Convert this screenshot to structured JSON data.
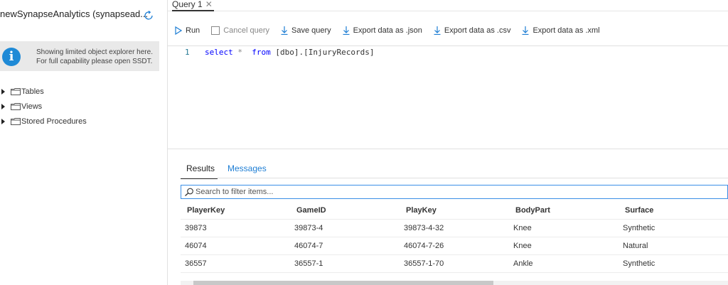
{
  "explorer": {
    "title": "newSynapseAnalytics (synapsead...",
    "info_line1": "Showing limited object explorer here.",
    "info_line2": "For full capability please open SSDT.",
    "tree": [
      {
        "label": "Tables"
      },
      {
        "label": "Views"
      },
      {
        "label": "Stored Procedures"
      }
    ]
  },
  "tabs": [
    {
      "label": "Query 1"
    }
  ],
  "toolbar": {
    "run": "Run",
    "cancel": "Cancel query",
    "save": "Save query",
    "export_json": "Export data as .json",
    "export_csv": "Export data as .csv",
    "export_xml": "Export data as .xml"
  },
  "editor": {
    "line_number": "1",
    "kw_select": "select",
    "star": "*",
    "kw_from": "from",
    "table": "[dbo].[InjuryRecords]"
  },
  "results": {
    "tab_results": "Results",
    "tab_messages": "Messages",
    "filter_placeholder": "Search to filter items...",
    "columns": [
      "PlayerKey",
      "GameID",
      "PlayKey",
      "BodyPart",
      "Surface"
    ],
    "rows": [
      [
        "39873",
        "39873-4",
        "39873-4-32",
        "Knee",
        "Synthetic"
      ],
      [
        "46074",
        "46074-7",
        "46074-7-26",
        "Knee",
        "Natural"
      ],
      [
        "36557",
        "36557-1",
        "36557-1-70",
        "Ankle",
        "Synthetic"
      ]
    ]
  },
  "colors": {
    "accent": "#1e7ed4",
    "info_icon": "#1f8ad6"
  }
}
